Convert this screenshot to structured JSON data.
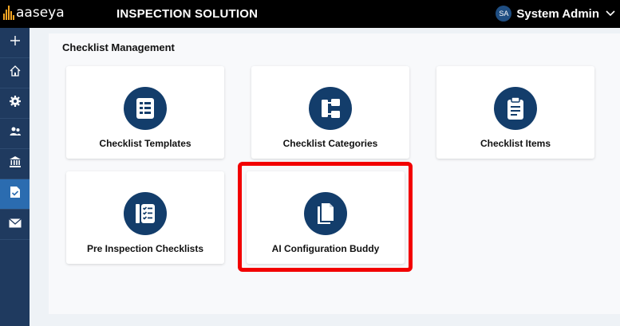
{
  "header": {
    "logo_text": "aaseya",
    "app_title": "INSPECTION SOLUTION",
    "user_initials": "SA",
    "user_name": "System Admin"
  },
  "sidebar": {
    "items": [
      {
        "icon": "plus-icon",
        "glyph": "+"
      },
      {
        "icon": "home-icon",
        "glyph": "⌂"
      },
      {
        "icon": "gear-icon",
        "glyph": "⚙"
      },
      {
        "icon": "users-icon",
        "glyph": "👥"
      },
      {
        "icon": "bank-icon",
        "glyph": "🏛"
      },
      {
        "icon": "document-icon",
        "glyph": "▤",
        "active": true
      },
      {
        "icon": "mail-icon",
        "glyph": "✉"
      }
    ]
  },
  "main": {
    "section_title": "Checklist Management",
    "cards": [
      {
        "label": "Checklist Templates",
        "icon": "list-document-icon"
      },
      {
        "label": "Checklist Categories",
        "icon": "hierarchy-icon"
      },
      {
        "label": "Checklist Items",
        "icon": "clipboard-icon"
      },
      {
        "label": "Pre Inspection Checklists",
        "icon": "checklist-icon"
      },
      {
        "label": "AI Configuration Buddy",
        "icon": "copy-document-icon",
        "highlighted": true
      }
    ]
  },
  "colors": {
    "topbar": "#000000",
    "sidebar": "#1f3a5f",
    "icon_circle": "#133d6b",
    "highlight": "#f20000"
  }
}
